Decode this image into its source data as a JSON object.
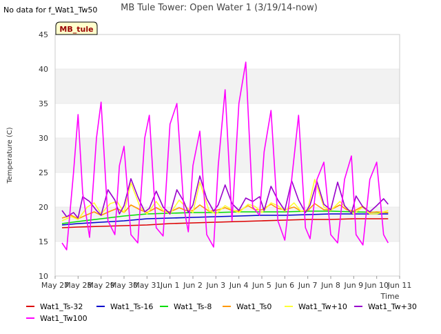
{
  "header": {
    "no_data_note": "No data for f_Wat1_Tw50",
    "site_badge": "MB_tule"
  },
  "colors": {
    "band": "#f2f2f2",
    "grid": "#dddddd",
    "badge_fill": "#ffffcc",
    "badge_text": "#990000"
  },
  "chart_data": {
    "type": "line",
    "title": "MB Tule Tower: Open Water 1 (3/19/14-now)",
    "xlabel": "Time",
    "ylabel": "Temperature (C)",
    "ylim": [
      10,
      45
    ],
    "xlim": [
      0,
      15
    ],
    "yticks": [
      10,
      15,
      20,
      25,
      30,
      35,
      40,
      45
    ],
    "xticks": [
      {
        "v": 0,
        "label": "May 27"
      },
      {
        "v": 1,
        "label": "May 28"
      },
      {
        "v": 2,
        "label": "May 29"
      },
      {
        "v": 3,
        "label": "May 30"
      },
      {
        "v": 4,
        "label": "May 31"
      },
      {
        "v": 5,
        "label": "Jun 1"
      },
      {
        "v": 6,
        "label": "Jun 2"
      },
      {
        "v": 7,
        "label": "Jun 3"
      },
      {
        "v": 8,
        "label": "Jun 4"
      },
      {
        "v": 9,
        "label": "Jun 5"
      },
      {
        "v": 10,
        "label": "Jun 6"
      },
      {
        "v": 11,
        "label": "Jun 7"
      },
      {
        "v": 12,
        "label": "Jun 8"
      },
      {
        "v": 13,
        "label": "Jun 9"
      },
      {
        "v": 14,
        "label": "Jun 10"
      },
      {
        "v": 15,
        "label": "Jun 11"
      }
    ],
    "grid": true,
    "legend_position": "bottom",
    "series": [
      {
        "name": "Wat1_Ts-32",
        "color": "#dd0000",
        "x": [
          0.3,
          1,
          2,
          3,
          4,
          5,
          6,
          7,
          8,
          9,
          10,
          11,
          12,
          13,
          14.5
        ],
        "y": [
          17.0,
          17.1,
          17.2,
          17.3,
          17.4,
          17.6,
          17.7,
          17.8,
          17.9,
          18.0,
          18.1,
          18.2,
          18.2,
          18.3,
          18.3
        ]
      },
      {
        "name": "Wat1_Ts-16",
        "color": "#0000cc",
        "x": [
          0.3,
          1,
          2,
          3,
          4,
          5,
          6,
          7,
          8,
          9,
          10,
          11,
          12,
          13,
          14.5
        ],
        "y": [
          17.4,
          17.6,
          17.8,
          18.0,
          18.3,
          18.4,
          18.5,
          18.6,
          18.7,
          18.8,
          18.8,
          18.9,
          19.0,
          19.0,
          19.0
        ]
      },
      {
        "name": "Wat1_Ts-8",
        "color": "#00dd00",
        "x": [
          0.3,
          1,
          2,
          3,
          4,
          5,
          6,
          7,
          8,
          9,
          10,
          11,
          12,
          13,
          14.5
        ],
        "y": [
          17.6,
          17.9,
          18.3,
          18.7,
          19.0,
          19.1,
          19.2,
          19.2,
          19.3,
          19.3,
          19.3,
          19.4,
          19.4,
          19.3,
          19.2
        ]
      },
      {
        "name": "Wat1_Ts0",
        "color": "#ff9900",
        "x": [
          0.3,
          0.7,
          1.0,
          1.4,
          1.7,
          2.0,
          2.4,
          2.7,
          3.0,
          3.3,
          3.7,
          4.0,
          4.4,
          4.7,
          5.0,
          5.4,
          5.7,
          6.0,
          6.3,
          6.7,
          7.0,
          7.4,
          7.7,
          8.0,
          8.4,
          8.7,
          9.0,
          9.4,
          9.7,
          10.0,
          10.4,
          10.7,
          11.0,
          11.3,
          11.7,
          12.0,
          12.4,
          12.7,
          13.0,
          13.4,
          13.7,
          14.0,
          14.5
        ],
        "y": [
          18.4,
          18.8,
          18.3,
          18.9,
          19.3,
          18.8,
          19.4,
          19.8,
          19.2,
          20.3,
          19.6,
          19.2,
          19.9,
          19.4,
          19.3,
          19.9,
          19.5,
          19.5,
          20.3,
          19.4,
          19.5,
          19.9,
          19.5,
          19.4,
          20.2,
          19.6,
          19.6,
          20.4,
          19.8,
          19.6,
          20.0,
          19.4,
          19.5,
          20.5,
          19.6,
          19.6,
          20.3,
          19.6,
          19.4,
          20.1,
          19.2,
          19.3,
          19.2
        ]
      },
      {
        "name": "Wat1_Tw+10",
        "color": "#ffff33",
        "x": [
          0.3,
          0.7,
          1.0,
          1.4,
          1.7,
          2.0,
          2.4,
          2.7,
          3.0,
          3.3,
          3.7,
          4.0,
          4.4,
          4.7,
          5.0,
          5.4,
          5.7,
          6.0,
          6.3,
          6.7,
          7.0,
          7.4,
          7.7,
          8.0,
          8.4,
          8.7,
          9.0,
          9.4,
          9.7,
          10.0,
          10.4,
          10.7,
          11.0,
          11.3,
          11.7,
          12.0,
          12.4,
          12.7,
          13.0,
          13.4,
          13.7,
          14.0,
          14.5
        ],
        "y": [
          18.0,
          18.6,
          18.2,
          20.0,
          20.6,
          19.0,
          20.5,
          20.8,
          19.2,
          23.5,
          20.0,
          19.0,
          20.8,
          19.5,
          19.0,
          21.0,
          20.0,
          19.2,
          23.6,
          19.5,
          19.0,
          20.2,
          19.6,
          19.2,
          20.4,
          20.1,
          19.2,
          20.6,
          20.2,
          19.4,
          20.6,
          19.4,
          19.6,
          24.0,
          20.0,
          19.5,
          20.8,
          19.8,
          19.0,
          20.0,
          19.0,
          19.0,
          19.5
        ]
      },
      {
        "name": "Wat1_Tw+30",
        "color": "#9900cc",
        "x": [
          0.3,
          0.5,
          0.8,
          1.0,
          1.2,
          1.5,
          1.8,
          2.0,
          2.3,
          2.6,
          2.8,
          3.0,
          3.3,
          3.6,
          3.9,
          4.1,
          4.4,
          4.7,
          5.0,
          5.3,
          5.6,
          5.8,
          6.0,
          6.3,
          6.6,
          6.9,
          7.1,
          7.4,
          7.7,
          8.0,
          8.3,
          8.6,
          8.9,
          9.1,
          9.4,
          9.7,
          10.0,
          10.3,
          10.6,
          10.9,
          11.1,
          11.4,
          11.7,
          12.0,
          12.3,
          12.6,
          12.9,
          13.1,
          13.4,
          13.7,
          14.0,
          14.3,
          14.5
        ],
        "y": [
          19.5,
          18.6,
          19.2,
          18.4,
          21.5,
          20.8,
          19.5,
          18.8,
          22.5,
          21.0,
          19.0,
          20.2,
          24.1,
          21.5,
          19.3,
          19.8,
          22.3,
          20.0,
          19.0,
          22.5,
          20.8,
          19.2,
          20.3,
          24.5,
          21.2,
          19.4,
          20.3,
          23.2,
          20.5,
          19.5,
          21.3,
          20.8,
          21.5,
          19.5,
          23.0,
          21.0,
          19.5,
          23.8,
          21.0,
          19.2,
          20.3,
          23.7,
          20.4,
          19.6,
          23.6,
          20.2,
          19.1,
          21.6,
          20.0,
          19.3,
          20.2,
          21.2,
          20.4
        ]
      },
      {
        "name": "Wat1_Tw100",
        "color": "#ff00ff",
        "x": [
          0.3,
          0.5,
          0.8,
          1.0,
          1.2,
          1.5,
          1.8,
          2.0,
          2.3,
          2.6,
          2.8,
          3.0,
          3.3,
          3.6,
          3.9,
          4.1,
          4.4,
          4.7,
          5.0,
          5.3,
          5.6,
          5.8,
          6.0,
          6.3,
          6.6,
          6.9,
          7.1,
          7.4,
          7.7,
          8.0,
          8.3,
          8.6,
          8.9,
          9.1,
          9.4,
          9.7,
          10.0,
          10.3,
          10.6,
          10.9,
          11.1,
          11.4,
          11.7,
          12.0,
          12.3,
          12.6,
          12.9,
          13.1,
          13.4,
          13.7,
          14.0,
          14.3,
          14.5
        ],
        "y": [
          14.8,
          13.8,
          25.0,
          33.4,
          22.0,
          15.6,
          30.0,
          35.2,
          18.0,
          16.0,
          26.0,
          28.8,
          16.0,
          14.8,
          30.0,
          33.3,
          17.0,
          15.8,
          32.0,
          35.0,
          20.0,
          16.4,
          26.0,
          31.0,
          16.0,
          14.2,
          26.0,
          37.0,
          18.0,
          35.0,
          41.0,
          20.0,
          18.8,
          28.0,
          34.0,
          18.0,
          15.2,
          24.0,
          33.3,
          17.0,
          15.4,
          24.0,
          26.5,
          16.0,
          14.8,
          24.0,
          27.4,
          16.0,
          14.5,
          24.0,
          26.5,
          16.0,
          14.8
        ]
      }
    ]
  }
}
